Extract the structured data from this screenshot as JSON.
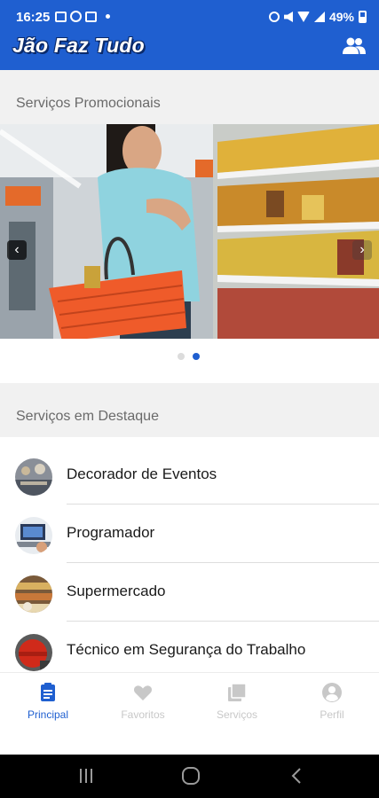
{
  "status_bar": {
    "time": "16:25",
    "battery": "49%"
  },
  "app_bar": {
    "title": "Jão Faz Tudo",
    "action_icon": "users-icon"
  },
  "promo": {
    "section_title": "Serviços Promocionais",
    "slide_count": 2,
    "active_slide": 2,
    "prev_icon": "chevron-left-icon",
    "next_icon": "chevron-right-icon"
  },
  "featured": {
    "section_title": "Serviços em Destaque",
    "items": [
      {
        "label": "Decorador de Eventos",
        "icon": "event-decor-avatar"
      },
      {
        "label": "Programador",
        "icon": "programmer-avatar"
      },
      {
        "label": "Supermercado",
        "icon": "supermarket-avatar"
      },
      {
        "label": "Técnico em Segurança do Trabalho",
        "icon": "safety-technician-avatar"
      }
    ]
  },
  "tabs": [
    {
      "label": "Principal",
      "icon": "clipboard-icon",
      "active": true
    },
    {
      "label": "Favoritos",
      "icon": "heart-icon",
      "active": false
    },
    {
      "label": "Serviços",
      "icon": "library-icon",
      "active": false
    },
    {
      "label": "Perfil",
      "icon": "account-circle-icon",
      "active": false
    }
  ],
  "colors": {
    "primary": "#1f5fd0",
    "section_bg": "#f1f1f1",
    "inactive_tab": "#c8c8c8"
  }
}
